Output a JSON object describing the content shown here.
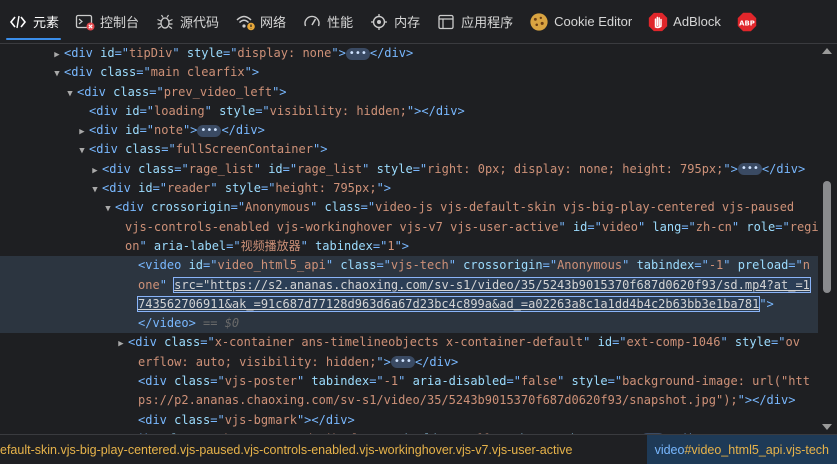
{
  "tabs": [
    {
      "label": "元素",
      "icon": "elements-icon",
      "active": true
    },
    {
      "label": "控制台",
      "icon": "console-icon",
      "active": false
    },
    {
      "label": "源代码",
      "icon": "bug-icon",
      "active": false
    },
    {
      "label": "网络",
      "icon": "wifi-icon",
      "active": false
    },
    {
      "label": "性能",
      "icon": "gauge-icon",
      "active": false
    },
    {
      "label": "内存",
      "icon": "chip-icon",
      "active": false
    },
    {
      "label": "应用程序",
      "icon": "app-window-icon",
      "active": false
    },
    {
      "label": "Cookie Editor",
      "icon": "cookie-icon",
      "active": false
    },
    {
      "label": "AdBlock",
      "icon": "adblock-hand-icon",
      "active": false
    },
    {
      "label": "ABP",
      "icon": "abp-icon",
      "active": false
    }
  ],
  "tree": [
    {
      "indent": 64,
      "toggle": "right",
      "parts": [
        [
          "t",
          "<div "
        ],
        [
          "a",
          "id"
        ],
        [
          "t",
          "=\""
        ],
        [
          "v",
          "tipDiv"
        ],
        [
          "t",
          "\" "
        ],
        [
          "a",
          "style"
        ],
        [
          "t",
          "=\""
        ],
        [
          "v",
          "display: none"
        ],
        [
          "t",
          "\">"
        ],
        [
          "e",
          ""
        ],
        [
          "t",
          "</div>"
        ]
      ]
    },
    {
      "indent": 64,
      "toggle": "down",
      "parts": [
        [
          "t",
          "<div "
        ],
        [
          "a",
          "class"
        ],
        [
          "t",
          "=\""
        ],
        [
          "v",
          "main clearfix"
        ],
        [
          "t",
          "\">"
        ]
      ]
    },
    {
      "indent": 77,
      "toggle": "down",
      "parts": [
        [
          "t",
          "<div "
        ],
        [
          "a",
          "class"
        ],
        [
          "t",
          "=\""
        ],
        [
          "v",
          "prev_video_left"
        ],
        [
          "t",
          "\">"
        ]
      ]
    },
    {
      "indent": 89,
      "toggle": "",
      "parts": [
        [
          "t",
          "<div "
        ],
        [
          "a",
          "id"
        ],
        [
          "t",
          "=\""
        ],
        [
          "v",
          "loading"
        ],
        [
          "t",
          "\" "
        ],
        [
          "a",
          "style"
        ],
        [
          "t",
          "=\""
        ],
        [
          "v",
          "visibility: hidden;"
        ],
        [
          "t",
          "\"></div>"
        ]
      ]
    },
    {
      "indent": 89,
      "toggle": "right",
      "parts": [
        [
          "t",
          "<div "
        ],
        [
          "a",
          "id"
        ],
        [
          "t",
          "=\""
        ],
        [
          "v",
          "note"
        ],
        [
          "t",
          "\">"
        ],
        [
          "e",
          ""
        ],
        [
          "t",
          "</div>"
        ]
      ]
    },
    {
      "indent": 89,
      "toggle": "down",
      "parts": [
        [
          "t",
          "<div "
        ],
        [
          "a",
          "class"
        ],
        [
          "t",
          "=\""
        ],
        [
          "v",
          "fullScreenContainer"
        ],
        [
          "t",
          "\">"
        ]
      ]
    },
    {
      "indent": 102,
      "toggle": "right",
      "parts": [
        [
          "t",
          "<div "
        ],
        [
          "a",
          "class"
        ],
        [
          "t",
          "=\""
        ],
        [
          "v",
          "rage_list"
        ],
        [
          "t",
          "\" "
        ],
        [
          "a",
          "id"
        ],
        [
          "t",
          "=\""
        ],
        [
          "v",
          "rage_list"
        ],
        [
          "t",
          "\" "
        ],
        [
          "a",
          "style"
        ],
        [
          "t",
          "=\""
        ],
        [
          "v",
          "right: 0px; display: none; height: 795px;"
        ],
        [
          "t",
          "\">"
        ],
        [
          "e",
          ""
        ],
        [
          "t",
          "</div>"
        ]
      ]
    },
    {
      "indent": 102,
      "toggle": "down",
      "parts": [
        [
          "t",
          "<div "
        ],
        [
          "a",
          "id"
        ],
        [
          "t",
          "=\""
        ],
        [
          "v",
          "reader"
        ],
        [
          "t",
          "\" "
        ],
        [
          "a",
          "style"
        ],
        [
          "t",
          "=\""
        ],
        [
          "v",
          "height: 795px;"
        ],
        [
          "t",
          "\">"
        ]
      ]
    },
    {
      "indent": 115,
      "toggle": "down",
      "parts": [
        [
          "t",
          "<div "
        ],
        [
          "a",
          "crossorigin"
        ],
        [
          "t",
          "=\""
        ],
        [
          "v",
          "Anonymous"
        ],
        [
          "t",
          "\" "
        ],
        [
          "a",
          "class"
        ],
        [
          "t",
          "=\""
        ],
        [
          "v",
          "video-js vjs-default-skin vjs-big-play-centered vjs-paused"
        ]
      ]
    },
    {
      "indent": 125,
      "toggle": "",
      "parts": [
        [
          "v",
          "vjs-controls-enabled vjs-workinghover vjs-v7 vjs-user-active"
        ],
        [
          "t",
          "\" "
        ],
        [
          "a",
          "id"
        ],
        [
          "t",
          "=\""
        ],
        [
          "v",
          "video"
        ],
        [
          "t",
          "\" "
        ],
        [
          "a",
          "lang"
        ],
        [
          "t",
          "=\""
        ],
        [
          "v",
          "zh-cn"
        ],
        [
          "t",
          "\" "
        ],
        [
          "a",
          "role"
        ],
        [
          "t",
          "=\""
        ],
        [
          "v",
          "regi"
        ]
      ]
    },
    {
      "indent": 125,
      "toggle": "",
      "parts": [
        [
          "v",
          "on"
        ],
        [
          "t",
          "\" "
        ],
        [
          "a",
          "aria-label"
        ],
        [
          "t",
          "=\""
        ],
        [
          "v",
          "视频播放器"
        ],
        [
          "t",
          "\" "
        ],
        [
          "a",
          "tabindex"
        ],
        [
          "t",
          "=\""
        ],
        [
          "v",
          "1"
        ],
        [
          "t",
          "\">"
        ]
      ]
    },
    {
      "indent": 138,
      "toggle": "",
      "sel": true,
      "parts": [
        [
          "t",
          "<video "
        ],
        [
          "a",
          "id"
        ],
        [
          "t",
          "=\""
        ],
        [
          "v",
          "video_html5_api"
        ],
        [
          "t",
          "\" "
        ],
        [
          "a",
          "class"
        ],
        [
          "t",
          "=\""
        ],
        [
          "v",
          "vjs-tech"
        ],
        [
          "t",
          "\" "
        ],
        [
          "a",
          "crossorigin"
        ],
        [
          "t",
          "=\""
        ],
        [
          "v",
          "Anonymous"
        ],
        [
          "t",
          "\" "
        ],
        [
          "a",
          "tabindex"
        ],
        [
          "t",
          "=\""
        ],
        [
          "v",
          "-1"
        ],
        [
          "t",
          "\" "
        ],
        [
          "a",
          "preload"
        ],
        [
          "t",
          "=\""
        ],
        [
          "v",
          "n"
        ]
      ]
    },
    {
      "indent": 138,
      "toggle": "",
      "sel": true,
      "parts": [
        [
          "v",
          "one"
        ],
        [
          "t",
          "\" "
        ],
        [
          "s",
          "src=\"https://s2.ananas.chaoxing.com/sv-s1/video/35/5243b9015370f687d0620f93/sd.mp4?at_=1"
        ]
      ]
    },
    {
      "indent": 138,
      "toggle": "",
      "sel": true,
      "parts": [
        [
          "s",
          "743562706911&ak_=91c687d77128d963d6a67d23bc4c899a&ad_=a02263a8c1a1dd4b4c2b63bb3e1ba781"
        ],
        [
          "t",
          "\">"
        ]
      ]
    },
    {
      "indent": 138,
      "toggle": "",
      "sel": true,
      "parts": [
        [
          "t",
          "</video>"
        ],
        [
          "d",
          " == $0"
        ]
      ]
    },
    {
      "indent": 128,
      "toggle": "right",
      "parts": [
        [
          "t",
          "<div "
        ],
        [
          "a",
          "class"
        ],
        [
          "t",
          "=\""
        ],
        [
          "v",
          "x-container ans-timelineobjects x-container-default"
        ],
        [
          "t",
          "\" "
        ],
        [
          "a",
          "id"
        ],
        [
          "t",
          "=\""
        ],
        [
          "v",
          "ext-comp-1046"
        ],
        [
          "t",
          "\" "
        ],
        [
          "a",
          "style"
        ],
        [
          "t",
          "=\""
        ],
        [
          "v",
          "ov"
        ]
      ]
    },
    {
      "indent": 138,
      "toggle": "",
      "parts": [
        [
          "v",
          "erflow: auto; visibility: hidden;"
        ],
        [
          "t",
          "\">"
        ],
        [
          "e",
          ""
        ],
        [
          "t",
          "</div>"
        ]
      ]
    },
    {
      "indent": 138,
      "toggle": "",
      "parts": [
        [
          "t",
          "<div "
        ],
        [
          "a",
          "class"
        ],
        [
          "t",
          "=\""
        ],
        [
          "v",
          "vjs-poster"
        ],
        [
          "t",
          "\" "
        ],
        [
          "a",
          "tabindex"
        ],
        [
          "t",
          "=\""
        ],
        [
          "v",
          "-1"
        ],
        [
          "t",
          "\" "
        ],
        [
          "a",
          "aria-disabled"
        ],
        [
          "t",
          "=\""
        ],
        [
          "v",
          "false"
        ],
        [
          "t",
          "\" "
        ],
        [
          "a",
          "style"
        ],
        [
          "t",
          "=\""
        ],
        [
          "v",
          "background-image: url(\"htt"
        ]
      ]
    },
    {
      "indent": 138,
      "toggle": "",
      "parts": [
        [
          "v",
          "ps://p2.ananas.chaoxing.com/sv-s1/video/35/5243b9015370f687d0620f93/snapshot.jpg\");"
        ],
        [
          "t",
          "\"></div>"
        ]
      ]
    },
    {
      "indent": 138,
      "toggle": "",
      "parts": [
        [
          "t",
          "<div "
        ],
        [
          "a",
          "class"
        ],
        [
          "t",
          "=\""
        ],
        [
          "v",
          "vjs-bgmark"
        ],
        [
          "t",
          "\"></div>"
        ]
      ]
    },
    {
      "indent": 128,
      "toggle": "right",
      "parts": [
        [
          "t",
          "<div "
        ],
        [
          "a",
          "class"
        ],
        [
          "t",
          "=\""
        ],
        [
          "v",
          "vjs-text-track-display"
        ],
        [
          "t",
          "\" "
        ],
        [
          "a",
          "aria-live"
        ],
        [
          "t",
          "=\""
        ],
        [
          "v",
          "off"
        ],
        [
          "t",
          "\" "
        ],
        [
          "a",
          "aria-atomic"
        ],
        [
          "t",
          "=\""
        ],
        [
          "v",
          "true"
        ],
        [
          "t",
          "\">"
        ],
        [
          "e",
          ""
        ],
        [
          "t",
          "</div>"
        ]
      ]
    }
  ],
  "breadcrumb": {
    "left": "efault-skin.vjs-big-play-centered.vjs-paused.vjs-controls-enabled.vjs-workinghover.vjs-v7.vjs-user-active",
    "right_tag": "video",
    "right_rest": "#video_html5_api.vjs-tech"
  }
}
